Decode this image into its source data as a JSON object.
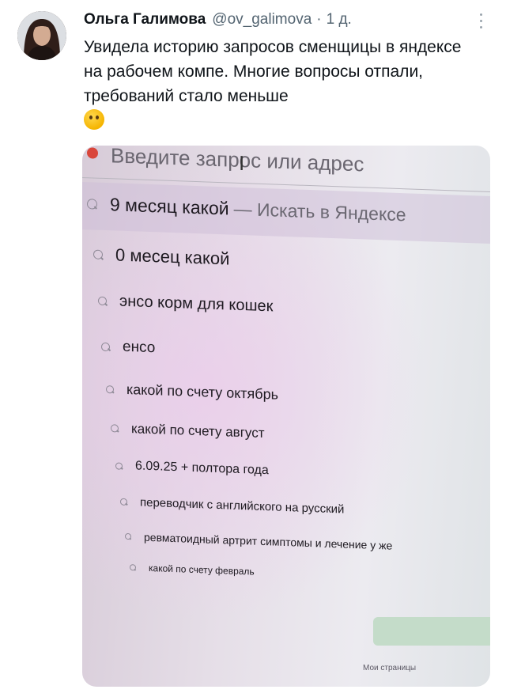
{
  "tweet": {
    "author_name": "Ольга Галимова",
    "handle": "@ov_galimova",
    "separator": "·",
    "time": "1 д.",
    "text": "Увидела историю запросов сменщицы в яндексе на рабочем компе. Многие вопросы отпали, требований стало меньше",
    "emoji": "thinking-face-emoji"
  },
  "screenshot": {
    "search_placeholder": "Введите запрос или адрес",
    "active_query": "9 месяц какой",
    "active_hint": "— Искать в Яндексе",
    "history": [
      "0 месец какой",
      "энсо корм для кошек",
      "енсо",
      "какой по счету октябрь",
      "какой по счету август",
      "6.09.25 + полтора года",
      "переводчик с английского на русский",
      "ревматоидный артрит симптомы и лечение у же",
      "какой по счету февраль"
    ],
    "footer_link": "Мои страницы"
  },
  "colors": {
    "name": "#0f1419",
    "meta": "#536471",
    "highlight": "#cdbed7",
    "green_button": "#c4dcc9"
  }
}
